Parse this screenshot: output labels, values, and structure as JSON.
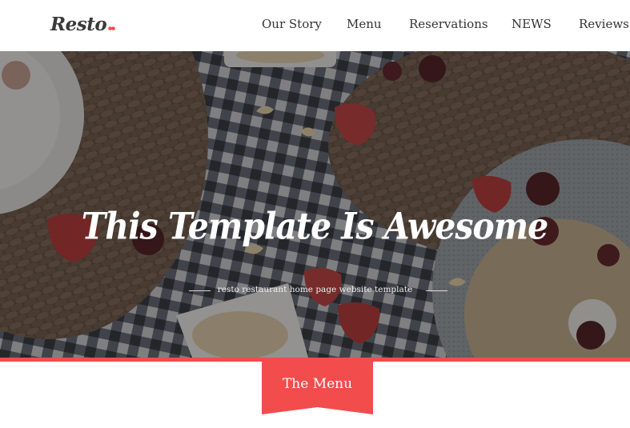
{
  "brand": {
    "name": "Resto",
    "accent_color": "#f24c4c",
    "text_color": "#333333"
  },
  "nav": {
    "items": [
      {
        "label": "Our Story"
      },
      {
        "label": "Menu"
      },
      {
        "label": "Reservations"
      },
      {
        "label": "NEWS"
      },
      {
        "label": "Reviews"
      }
    ]
  },
  "hero": {
    "title": "This Template Is Awesome",
    "subtitle": "resto restaurant home page website template"
  },
  "section": {
    "menu_label": "The Menu"
  }
}
